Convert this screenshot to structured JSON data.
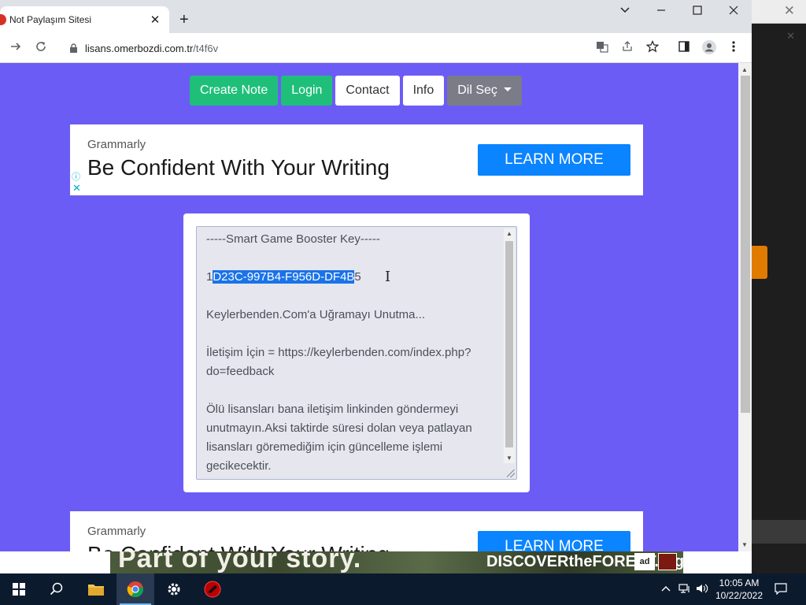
{
  "browser": {
    "tab_title": "Not Paylaşım Sitesi",
    "url_host": "lisans.omerbozdi.com.tr",
    "url_path": "/t4f6v"
  },
  "nav": {
    "create_note": "Create Note",
    "login": "Login",
    "contact": "Contact",
    "info": "Info",
    "language": "Dil Seç"
  },
  "ad_top": {
    "brand": "Grammarly",
    "headline": "Be Confident With Your Writing",
    "cta": "LEARN MORE"
  },
  "ad_bottom": {
    "brand": "Grammarly",
    "headline": "Be Confident With Your Writing",
    "cta": "LEARN MORE"
  },
  "note": {
    "header": "-----Smart Game Booster Key-----",
    "key_prefix": "1",
    "key_selected": "D23C-997B4-F956D-DF4B",
    "key_suffix": "5",
    "line3": "Keylerbenden.Com'a Uğramayı Unutma...",
    "line4": "İletişim İçin = https://keylerbenden.com/index.php?do=feedback",
    "line5": "Ölü lisansları bana iletişim linkinden göndermeyi unutmayın.Aksi taktirde süresi dolan veya patlayan lisansları göremediğim için güncelleme işlemi gecikecektir."
  },
  "banner_bottom": {
    "left_text": "Part of your story.",
    "right_text": "DISCOVERtheFOREST.org",
    "logo_text": "ad"
  },
  "taskbar": {
    "time": "10:05 AM",
    "date": "10/22/2022"
  },
  "colors": {
    "page_bg": "#6c5cf6",
    "green_btn": "#1fbf7a",
    "cta_blue": "#0a84ff",
    "selection": "#1a73e8"
  }
}
